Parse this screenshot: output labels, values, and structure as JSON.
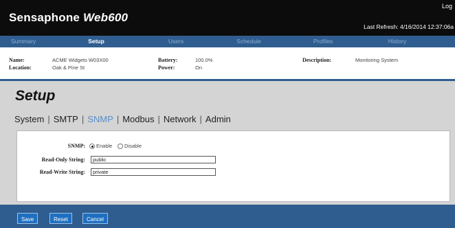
{
  "header": {
    "brand": "Sensaphone",
    "model": "Web600",
    "logout_label": "Log",
    "last_refresh": "Last Refresh: 4/16/2014 12:37:06a"
  },
  "nav": {
    "items": [
      {
        "label": "Summary",
        "active": false
      },
      {
        "label": "Setup",
        "active": true
      },
      {
        "label": "Users",
        "active": false
      },
      {
        "label": "Schedule",
        "active": false
      },
      {
        "label": "Profiles",
        "active": false
      },
      {
        "label": "History",
        "active": false
      }
    ]
  },
  "device_info": {
    "name_label": "Name:",
    "name_value": "ACME Widgets W03X00",
    "location_label": "Location:",
    "location_value": "Oak & Pine St",
    "battery_label": "Battery:",
    "battery_value": "100.0%",
    "power_label": "Power:",
    "power_value": "On",
    "description_label": "Description:",
    "description_value": "Monitoring System"
  },
  "page": {
    "title": "Setup",
    "subnav": [
      {
        "label": "System",
        "active": false
      },
      {
        "label": "SMTP",
        "active": false
      },
      {
        "label": "SNMP",
        "active": true
      },
      {
        "label": "Modbus",
        "active": false
      },
      {
        "label": "Network",
        "active": false
      },
      {
        "label": "Admin",
        "active": false
      }
    ]
  },
  "form": {
    "snmp_label": "SNMP:",
    "enable_label": "Enable",
    "disable_label": "Disable",
    "selected": "Enable",
    "read_only_label": "Read-Only String:",
    "read_only_value": "public",
    "read_write_label": "Read-Write String:",
    "read_write_value": "private"
  },
  "buttons": {
    "save": "Save",
    "reset": "Reset",
    "cancel": "Cancel"
  },
  "colors": {
    "topbar": "#0c0c0c",
    "navbar": "#2f5d8f",
    "active_subnav": "#5a8ec8",
    "content_bg": "#d4d4d4",
    "button": "#1f6fc0"
  }
}
